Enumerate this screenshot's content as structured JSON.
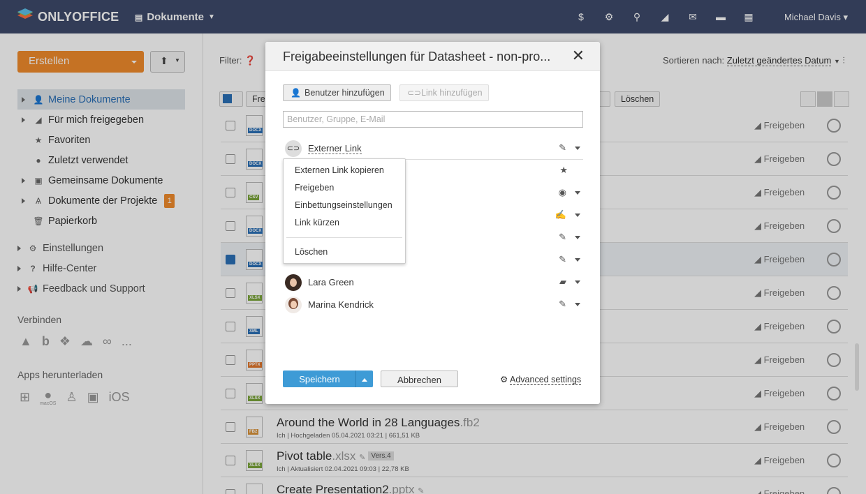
{
  "app": {
    "logo": "ONLYOFFICE",
    "module": "Dokumente",
    "user": "Michael Davis"
  },
  "sidebar": {
    "create_label": "Erstellen",
    "items": [
      {
        "label": "Meine Dokumente",
        "icon": "person-icon",
        "active": true
      },
      {
        "label": "Für mich freigegeben",
        "icon": "shared-icon"
      },
      {
        "label": "Favoriten",
        "icon": "star-icon"
      },
      {
        "label": "Zuletzt verwendet",
        "icon": "clock-icon"
      },
      {
        "label": "Gemeinsame Dokumente",
        "icon": "briefcase-icon"
      },
      {
        "label": "Dokumente der Projekte",
        "icon": "projects-icon",
        "badge": "1"
      },
      {
        "label": "Papierkorb",
        "icon": "trash-icon"
      }
    ],
    "settings_items": [
      {
        "label": "Einstellungen",
        "icon": "gear-icon"
      },
      {
        "label": "Hilfe-Center",
        "icon": "question-icon"
      },
      {
        "label": "Feedback und Support",
        "icon": "megaphone-icon"
      }
    ],
    "connect_title": "Verbinden",
    "connect_more": "...",
    "apps_title": "Apps herunterladen",
    "apps_macos": "macOS",
    "apps_ios": "iOS"
  },
  "main": {
    "filter_label": "Filter:",
    "sort_label": "Sortieren nach:",
    "sort_value": "Zuletzt geändertes Datum",
    "toolbar_partial": "Fre",
    "toolbar_delete": "Löschen",
    "share_label": "Freigeben",
    "rows": [
      {
        "ext": "DOCX"
      },
      {
        "ext": "DOCX"
      },
      {
        "ext": "CSV"
      },
      {
        "ext": "DOCX"
      },
      {
        "ext": "DOCX",
        "checked": true
      },
      {
        "ext": "XLSX"
      },
      {
        "ext": "XML"
      },
      {
        "ext": "PPTX"
      },
      {
        "ext": "XLSX"
      },
      {
        "ext": "FB2",
        "name": "Around the World in 28 Languages",
        "ext_label": ".fb2",
        "meta": "Ich | Hochgeladen 05.04.2021 03:21 | 661,51 KB"
      },
      {
        "ext": "XLSX",
        "name": "Pivot table",
        "ext_label": ".xlsx",
        "version": "Vers.4",
        "meta": "Ich | Aktualisiert 02.04.2021 09:03 | 22,78 KB"
      },
      {
        "ext": "PPTX",
        "name": "Create Presentation2",
        "ext_label": ".pptx"
      }
    ]
  },
  "dialog": {
    "title": "Freigabeeinstellungen für Datasheet - non-pro...",
    "add_user": "Benutzer hinzufügen",
    "add_link": "Link hinzufügen",
    "search_placeholder": "Benutzer, Gruppe, E-Mail",
    "external_link": "Externer Link",
    "users": [
      {
        "name": "Lara Green"
      },
      {
        "name": "Marina Kendrick"
      }
    ],
    "context_menu": [
      "Externen Link kopieren",
      "Freigeben",
      "Einbettungseinstellungen",
      "Link kürzen",
      "Löschen"
    ],
    "save": "Speichern",
    "cancel": "Abbrechen",
    "advanced": "Advanced settings"
  }
}
